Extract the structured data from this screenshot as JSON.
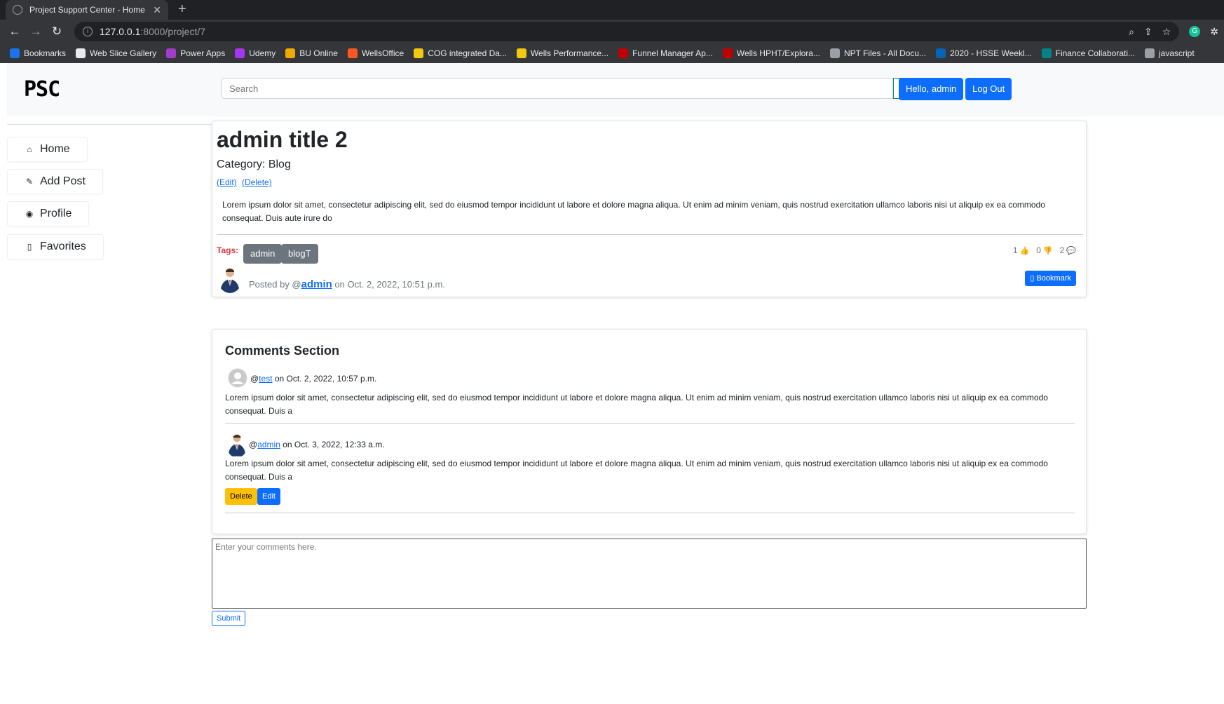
{
  "browser": {
    "tab_title": "Project Support Center - Home",
    "url_host": "127.0.0.1",
    "url_path": ":8000/project/7",
    "bookmarks": [
      {
        "label": "Bookmarks",
        "color": "#1a73e8"
      },
      {
        "label": "Web Slice Gallery",
        "color": "#e8eaed"
      },
      {
        "label": "Power Apps",
        "color": "#a33dc9"
      },
      {
        "label": "Udemy",
        "color": "#a435f0"
      },
      {
        "label": "BU Online",
        "color": "#f2a900"
      },
      {
        "label": "WellsOffice",
        "color": "#ff5722"
      },
      {
        "label": "COG integrated Da...",
        "color": "#f2c811"
      },
      {
        "label": "Wells Performance...",
        "color": "#f2c811"
      },
      {
        "label": "Funnel Manager Ap...",
        "color": "#c00000"
      },
      {
        "label": "Wells HPHT/Explora...",
        "color": "#c00000"
      },
      {
        "label": "NPT Files - All Docu...",
        "color": "#9aa0a6"
      },
      {
        "label": "2020 - HSSE Weekl...",
        "color": "#0364b8"
      },
      {
        "label": "Finance Collaborati...",
        "color": "#038387"
      },
      {
        "label": "javascript",
        "color": "#9aa0a6"
      }
    ]
  },
  "header": {
    "logo": "PSC",
    "search_placeholder": "Search",
    "hello_button": "Hello, admin",
    "logout_button": "Log Out"
  },
  "sidebar": {
    "items": [
      {
        "label": "Home",
        "icon": "home-icon"
      },
      {
        "label": "Add Post",
        "icon": "pencil-icon"
      },
      {
        "label": "Profile",
        "icon": "user-circle-icon"
      },
      {
        "label": "Favorites",
        "icon": "bookmark-icon"
      }
    ]
  },
  "post": {
    "title": "admin title 2",
    "category": "Category: Blog",
    "edit_link": "(Edit)",
    "delete_link": "(Delete)",
    "body": "Lorem ipsum dolor sit amet, consectetur adipiscing elit, sed do eiusmod tempor incididunt ut labore et dolore magna aliqua. Ut enim ad minim veniam, quis nostrud exercitation ullamco laboris nisi ut aliquip ex ea commodo consequat. Duis aute irure do",
    "tags_label": "Tags:",
    "tags": [
      "admin",
      "blogT"
    ],
    "likes": "1",
    "dislikes": "0",
    "comments_count": "2",
    "posted_prefix": "Posted by @",
    "author": "admin",
    "posted_suffix": " on Oct. 2, 2022, 10:51 p.m.",
    "bookmark_button": "Bookmark"
  },
  "comments": {
    "title": "Comments Section",
    "items": [
      {
        "user": "test",
        "date": " on Oct. 2, 2022, 10:57 p.m.",
        "body": "Lorem ipsum dolor sit amet, consectetur adipiscing elit, sed do eiusmod tempor incididunt ut labore et dolore magna aliqua. Ut enim ad minim veniam, quis nostrud exercitation ullamco laboris nisi ut aliquip ex ea commodo consequat. Duis a"
      },
      {
        "user": "admin",
        "date": " on Oct. 3, 2022, 12:33 a.m.",
        "body": "Lorem ipsum dolor sit amet, consectetur adipiscing elit, sed do eiusmod tempor incididunt ut labore et dolore magna aliqua. Ut enim ad minim veniam, quis nostrud exercitation ullamco laboris nisi ut aliquip ex ea commodo consequat. Duis a",
        "delete_button": "Delete",
        "edit_button": "Edit"
      }
    ],
    "input_placeholder": "Enter your comments here.",
    "submit_button": "Submit"
  },
  "colors": {
    "primary": "#0d6efd",
    "warning": "#ffc107",
    "tag": "#6c757d",
    "danger": "#dc3545"
  }
}
